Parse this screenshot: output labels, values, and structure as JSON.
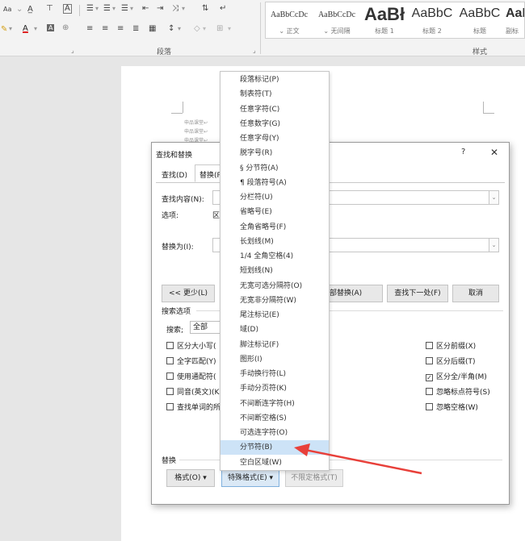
{
  "ribbon": {
    "font_row1": [
      "Aa",
      "A",
      "A"
    ],
    "font_row2": [
      "A"
    ],
    "paragraph_label": "段落",
    "styles_label": "样式",
    "style_tiles": [
      {
        "sample": "AaBbCcDc",
        "name": "⌄ 正文"
      },
      {
        "sample": "AaBbCcDc",
        "name": "⌄ 无间隔"
      },
      {
        "sample": "AaBł",
        "name": "标题 1"
      },
      {
        "sample": "AaBbC",
        "name": "标题 2"
      },
      {
        "sample": "AaBbC",
        "name": "标题"
      },
      {
        "sample": "AaI",
        "name": "副标"
      }
    ]
  },
  "document": {
    "lines": [
      "申品课堂↩",
      "申品课堂↩",
      "申品课堂↩"
    ]
  },
  "dialog": {
    "title": "查找和替换",
    "help": "?",
    "close": "✕",
    "tabs": [
      "查找(D)",
      "替换(P)"
    ],
    "find_label": "查找内容(N):",
    "options_label": "选项:",
    "options_value": "区",
    "replace_label": "替换为(I):",
    "less_button": "<< 更少(L)",
    "replace_all_button": "部替换(A)",
    "find_next_button": "查找下一处(F)",
    "cancel_button": "取消",
    "search_options_label": "搜索选项",
    "search_label": "搜索;",
    "search_value": "全部",
    "left_checks": [
      {
        "label": "区分大小写(",
        "checked": false
      },
      {
        "label": "全字匹配(Y)",
        "checked": false
      },
      {
        "label": "使用通配符(",
        "checked": false
      },
      {
        "label": "同音(英文)(K",
        "checked": false
      },
      {
        "label": "查找单词的所",
        "checked": false
      }
    ],
    "right_checks": [
      {
        "label": "区分前缀(X)",
        "checked": false
      },
      {
        "label": "区分后缀(T)",
        "checked": false
      },
      {
        "label": "区分全/半角(M)",
        "checked": true
      },
      {
        "label": "忽略标点符号(S)",
        "checked": false
      },
      {
        "label": "忽略空格(W)",
        "checked": false
      }
    ],
    "replace_group_label": "替换",
    "format_button": "格式(O) ▾",
    "special_button": "特殊格式(E) ▾",
    "no_format_button": "不限定格式(T)"
  },
  "special_menu": {
    "items": [
      "段落标记(P)",
      "制表符(T)",
      "任意字符(C)",
      "任意数字(G)",
      "任意字母(Y)",
      "脱字号(R)",
      "§ 分节符(A)",
      "¶ 段落符号(A)",
      "分栏符(U)",
      "省略号(E)",
      "全角省略号(F)",
      "长划线(M)",
      "1/4 全角空格(4)",
      "短划线(N)",
      "无宽可选分隔符(O)",
      "无宽非分隔符(W)",
      "尾注标记(E)",
      "域(D)",
      "脚注标记(F)",
      "图形(I)",
      "手动换行符(L)",
      "手动分页符(K)",
      "不间断连字符(H)",
      "不间断空格(S)",
      "可选连字符(O)",
      "分节符(B)",
      "空白区域(W)"
    ],
    "highlighted_index": 25
  },
  "colors": {
    "highlight": "#cde3f7",
    "arrow": "#e8403a"
  }
}
